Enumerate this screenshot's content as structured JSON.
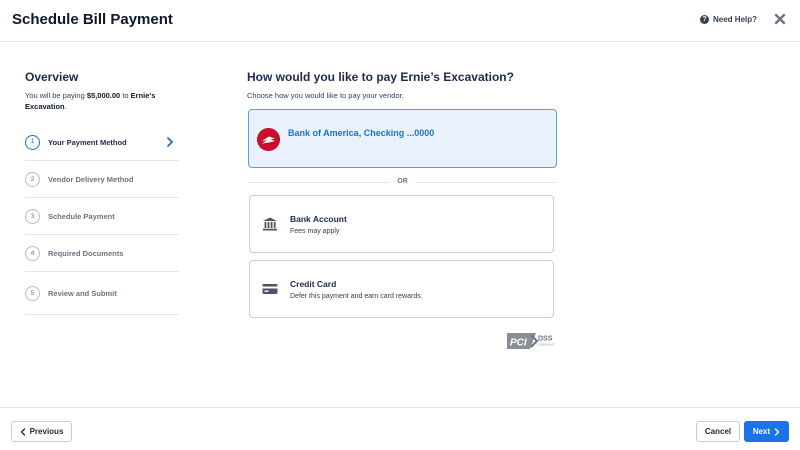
{
  "header": {
    "title": "Schedule Bill Payment",
    "help_label": "Need Help?",
    "help_icon_glyph": "?"
  },
  "overview": {
    "title": "Overview",
    "desc_prefix": "You will be paying ",
    "amount": "$5,000.00",
    "desc_mid": " to ",
    "vendor": "Ernie's Excavation",
    "desc_suffix": "."
  },
  "steps": [
    {
      "num": "1",
      "label": "Your Payment Method",
      "active": true
    },
    {
      "num": "2",
      "label": "Vendor Delivery Method",
      "active": false
    },
    {
      "num": "3",
      "label": "Schedule Payment",
      "active": false
    },
    {
      "num": "4",
      "label": "Required Documents",
      "active": false
    },
    {
      "num": "5",
      "label": "Review and Submit",
      "active": false
    }
  ],
  "main": {
    "question": "How would you like to pay Ernie’s Excavation?",
    "subtitle": "Choose how you would like to pay your vendor.",
    "selected_method": {
      "name": "Bank of America, Checking ...0000",
      "icon": "bank-of-america-logo"
    },
    "divider_label": "OR",
    "options": [
      {
        "title": "Bank Account",
        "desc": "Fees may apply",
        "icon": "bank-icon"
      },
      {
        "title": "Credit Card",
        "desc": "Defer this payment and earn card rewards.",
        "icon": "credit-card-icon"
      }
    ],
    "badge": {
      "pci_text": "PCI",
      "dss_text": "DSS",
      "compliant_text": "COMPLIANT"
    }
  },
  "footer": {
    "previous_label": "Previous",
    "cancel_label": "Cancel",
    "next_label": "Next"
  },
  "colors": {
    "accent": "#1a73e8",
    "selected_bg": "#e9f2fc",
    "boa_red": "#c8102e",
    "heading": "#1e2a4a"
  }
}
